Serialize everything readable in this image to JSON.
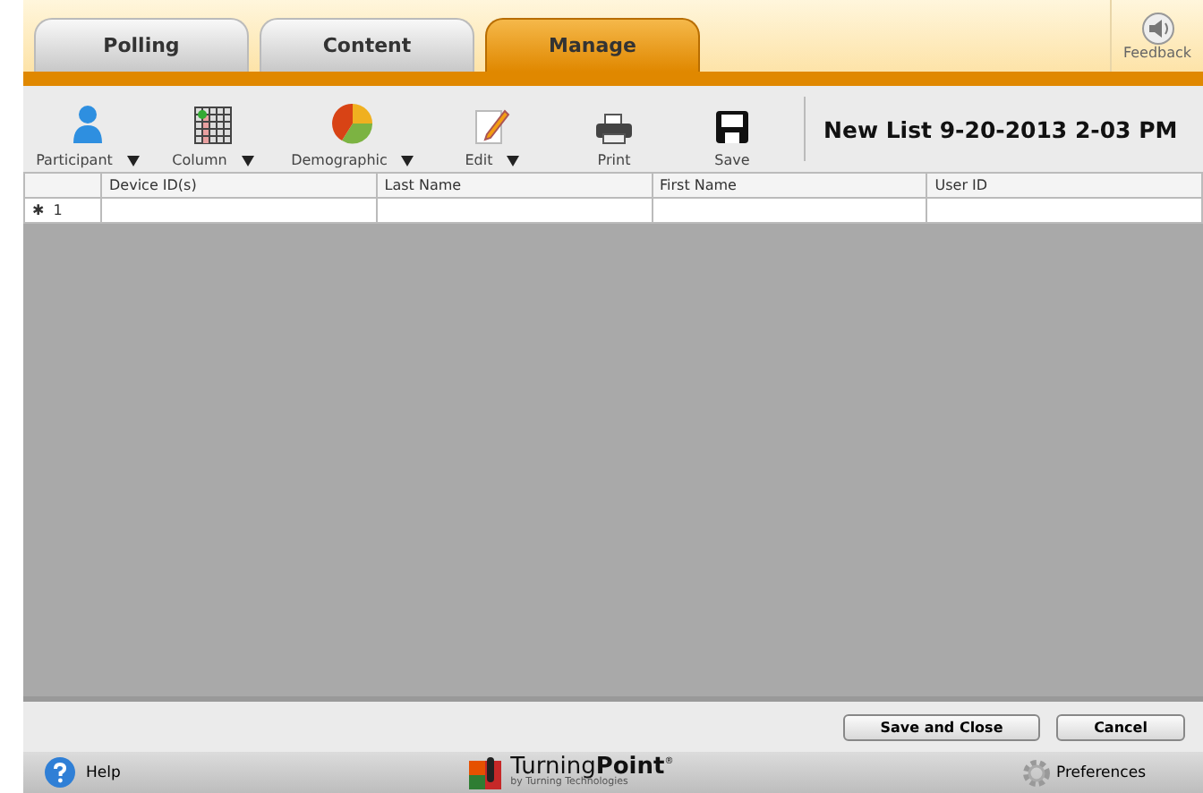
{
  "tabs": [
    {
      "label": "Polling",
      "selected": false
    },
    {
      "label": "Content",
      "selected": false
    },
    {
      "label": "Manage",
      "selected": true
    }
  ],
  "feedback": {
    "label": "Feedback"
  },
  "toolbar": [
    {
      "kind": "participant",
      "label": "Participant",
      "dropdown": true
    },
    {
      "kind": "column",
      "label": "Column",
      "dropdown": true
    },
    {
      "kind": "demographic",
      "label": "Demographic",
      "dropdown": true
    },
    {
      "kind": "edit",
      "label": "Edit",
      "dropdown": true
    },
    {
      "kind": "print",
      "label": "Print",
      "dropdown": false
    },
    {
      "kind": "save",
      "label": "Save",
      "dropdown": false
    }
  ],
  "list_title": "New List 9-20-2013 2-03 PM",
  "table": {
    "columns": [
      "Device ID(s)",
      "Last Name",
      "First Name",
      "User ID"
    ],
    "rows": [
      {
        "marker": "✱",
        "number": "1"
      }
    ]
  },
  "buttons": [
    "Save and Close",
    "Cancel"
  ],
  "footer": {
    "help": "Help",
    "brand": "Turning",
    "brand_bold": "Point",
    "brand_mark": "®",
    "byline": "by Turning Technologies",
    "preferences": "Preferences"
  }
}
